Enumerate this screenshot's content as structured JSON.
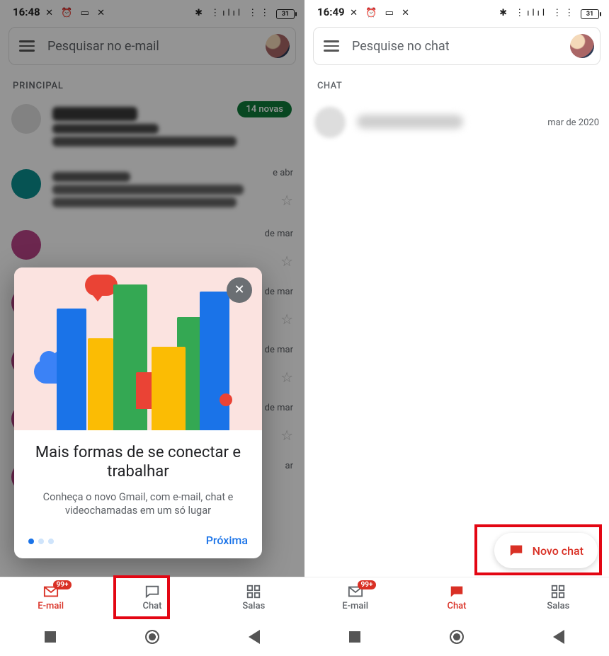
{
  "left": {
    "status": {
      "time": "16:48",
      "left_icons": "✕ ⏰ ▭ ✕",
      "right_icons": "✱ ⋮ılıl ⋮⋮",
      "battery": "31"
    },
    "search_placeholder": "Pesquisar no e-mail",
    "section": "PRINCIPAL",
    "new_badge": "14 novas",
    "rows": [
      {
        "date": ""
      },
      {
        "date": "e abr"
      },
      {
        "date": "de mar"
      },
      {
        "date": "de mar"
      },
      {
        "date": "de mar"
      },
      {
        "date": "de mar"
      },
      {
        "date": "ar"
      }
    ],
    "popup": {
      "title": "Mais formas de se conectar e trabalhar",
      "body": "Conheça o novo Gmail, com e-mail, chat e videochamadas em um só lugar",
      "next": "Próxima"
    },
    "tabs": {
      "email": "E-mail",
      "chat": "Chat",
      "salas": "Salas",
      "email_count": "99+"
    }
  },
  "right": {
    "status": {
      "time": "16:49",
      "left_icons": "✕ ⏰ ▭ ✕",
      "right_icons": "✱ ⋮ılıl ⋮⋮",
      "battery": "31"
    },
    "search_placeholder": "Pesquise no chat",
    "section": "CHAT",
    "chat_date": "mar de 2020",
    "fab": "Novo chat",
    "tabs": {
      "email": "E-mail",
      "chat": "Chat",
      "salas": "Salas",
      "email_count": "99+"
    }
  }
}
